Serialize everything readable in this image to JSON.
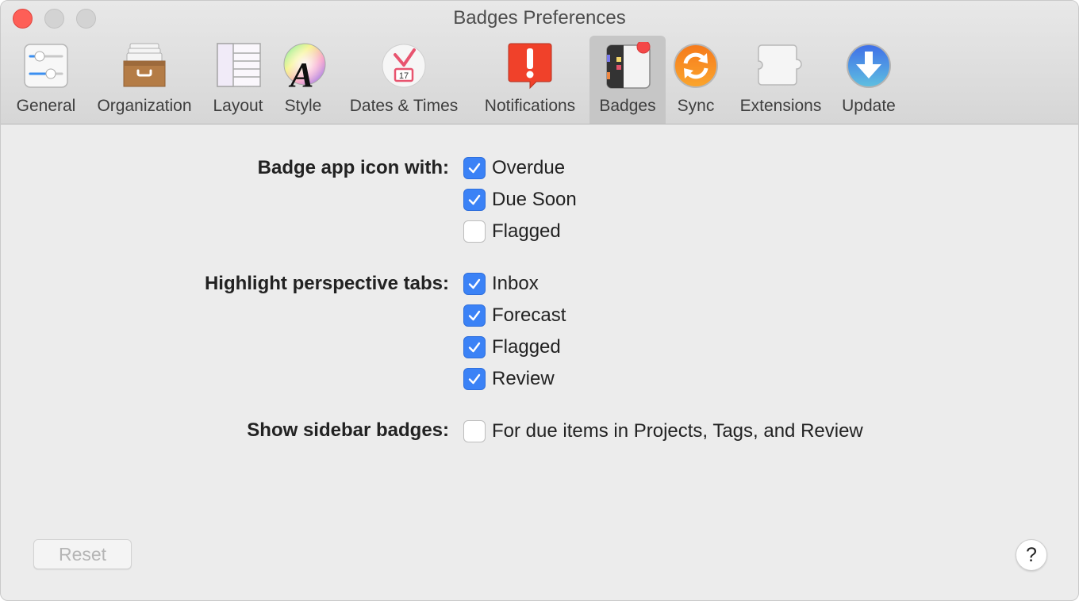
{
  "window": {
    "title": "Badges Preferences"
  },
  "toolbar": {
    "items": [
      {
        "label": "General",
        "icon": "sliders-icon",
        "active": false
      },
      {
        "label": "Organization",
        "icon": "drawer-icon",
        "active": false
      },
      {
        "label": "Layout",
        "icon": "layout-icon",
        "active": false
      },
      {
        "label": "Style",
        "icon": "color-wheel-font-icon",
        "active": false
      },
      {
        "label": "Dates & Times",
        "icon": "clock-calendar-icon",
        "calendar_day": "17",
        "active": false
      },
      {
        "label": "Notifications",
        "icon": "exclamation-bubble-icon",
        "active": false
      },
      {
        "label": "Badges",
        "icon": "badge-app-icon",
        "active": true
      },
      {
        "label": "Sync",
        "icon": "sync-icon",
        "active": false
      },
      {
        "label": "Extensions",
        "icon": "puzzle-piece-icon",
        "active": false
      },
      {
        "label": "Update",
        "icon": "download-arrow-icon",
        "active": false
      }
    ]
  },
  "sections": {
    "badge_app_icon": {
      "label": "Badge app icon with:",
      "options": [
        {
          "label": "Overdue",
          "checked": true
        },
        {
          "label": "Due Soon",
          "checked": true
        },
        {
          "label": "Flagged",
          "checked": false
        }
      ]
    },
    "highlight_tabs": {
      "label": "Highlight perspective tabs:",
      "options": [
        {
          "label": "Inbox",
          "checked": true
        },
        {
          "label": "Forecast",
          "checked": true
        },
        {
          "label": "Flagged",
          "checked": true
        },
        {
          "label": "Review",
          "checked": true
        }
      ]
    },
    "sidebar_badges": {
      "label": "Show sidebar badges:",
      "options": [
        {
          "label": "For due items in Projects, Tags, and Review",
          "checked": false
        }
      ]
    }
  },
  "footer": {
    "reset_label": "Reset",
    "reset_enabled": false,
    "help_label": "?"
  },
  "colors": {
    "accent": "#3b82f6",
    "close": "#fe5f57",
    "notification_red": "#f0412a",
    "sync_orange": "#f58a1f",
    "update_blue": "#3f7ee8"
  }
}
